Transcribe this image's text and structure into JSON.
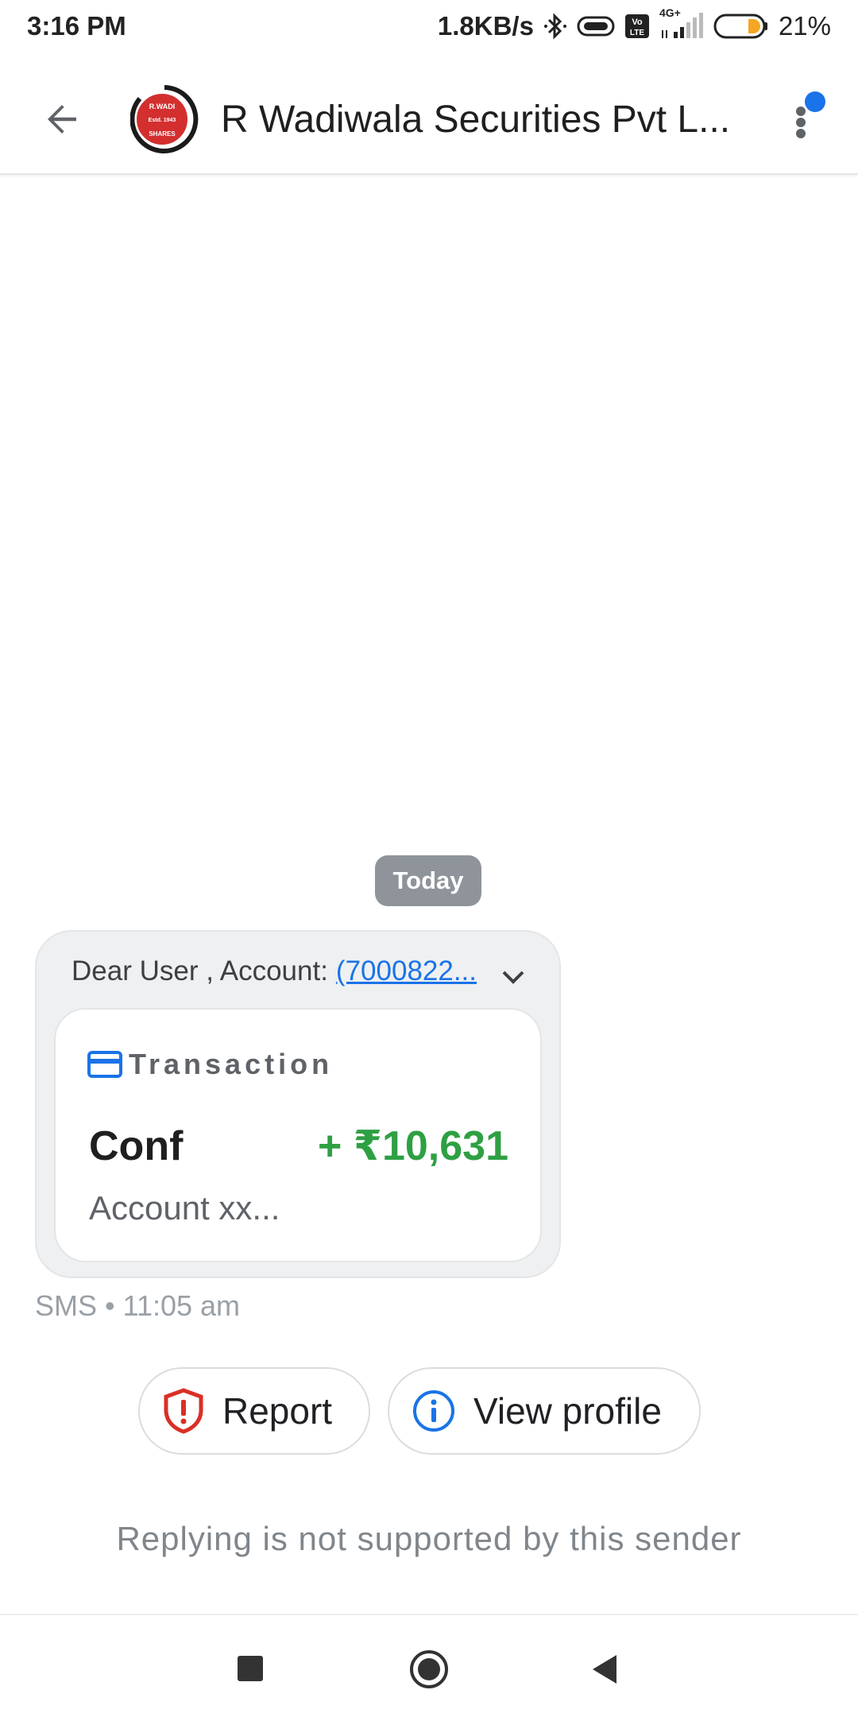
{
  "status_bar": {
    "time": "3:16 PM",
    "net_speed": "1.8KB/s",
    "network_label": "4G+",
    "battery": "21%"
  },
  "app_bar": {
    "sender": "R Wadiwala Securities Pvt L...",
    "avatar_text_top": "R.WADI",
    "avatar_text_mid": "Estd. 1943",
    "avatar_text_bottom": "SHARES"
  },
  "conversation": {
    "date_chip": "Today",
    "message": {
      "header_prefix": "Dear User , Account:",
      "header_link": "(7000822...",
      "card_title": "Transaction",
      "card_label": "Conf",
      "card_amount": "+ ₹10,631",
      "card_account": "Account xx...",
      "meta": "SMS • 11:05 am"
    }
  },
  "actions": {
    "report_label": "Report",
    "view_profile_label": "View profile"
  },
  "reply_note": "Replying is not supported by this sender",
  "colors": {
    "accent_blue": "#1a73e8",
    "amount_green": "#2ea043",
    "report_red": "#d93025"
  }
}
